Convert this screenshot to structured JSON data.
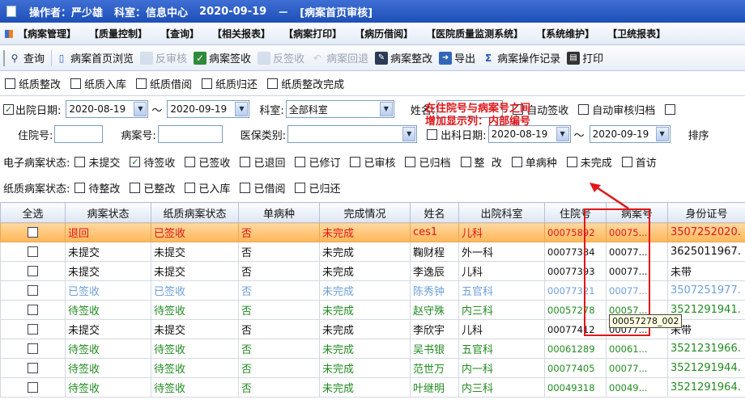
{
  "titlebar": {
    "operator": "操作者：严少雄",
    "dept": "科室：信息中心",
    "date": "2020-09-19",
    "dash": "－",
    "title": "[病案首页审核]"
  },
  "menu": [
    "【病案管理】",
    "【质量控制】",
    "【查询】",
    "【相关报表】",
    "【病案打印】",
    "【病历借阅】",
    "【医院质量监测系统】",
    "【系统维护】",
    "【卫统报表】"
  ],
  "toolbar": [
    {
      "label": "查询",
      "icon": "search-icon",
      "enabled": true
    },
    {
      "label": "病案首页浏览",
      "icon": "document-icon",
      "enabled": true
    },
    {
      "label": "反审核",
      "icon": "undo-icon",
      "enabled": false
    },
    {
      "label": "病案签收",
      "icon": "check-icon",
      "enabled": true
    },
    {
      "label": "反签收",
      "icon": "undo-icon",
      "enabled": false
    },
    {
      "label": "病案回退",
      "icon": "return-icon",
      "enabled": false
    },
    {
      "label": "病案整改",
      "icon": "edit-icon",
      "enabled": true
    },
    {
      "label": "导出",
      "icon": "export-icon",
      "enabled": true
    },
    {
      "label": "病案操作记录",
      "icon": "sigma-icon",
      "enabled": true
    },
    {
      "label": "打印",
      "icon": "print-icon",
      "enabled": true
    }
  ],
  "paper_ops": [
    "纸质整改",
    "纸质入库",
    "纸质借阅",
    "纸质归还",
    "纸质整改完成"
  ],
  "filters": {
    "discharge_date_label": "出院日期:",
    "date_from": "2020-08-19",
    "tilde": "～",
    "date_to": "2020-09-19",
    "dept_label": "科室:",
    "dept_value": "全部科室",
    "name_label": "姓名:",
    "auto_sign": "自动签收",
    "auto_archive": "自动审核归档",
    "inpatient_label": "住院号:",
    "record_label": "病案号:",
    "insurance_label": "医保类别:",
    "out_date_label": "出科日期:",
    "out_from": "2020-08-19",
    "out_to": "2020-09-19",
    "sort_label": "排序"
  },
  "e_status": {
    "label": "电子病案状态:",
    "options": [
      {
        "text": "未提交",
        "checked": false
      },
      {
        "text": "待签收",
        "checked": true
      },
      {
        "text": "已签收",
        "checked": false
      },
      {
        "text": "已退回",
        "checked": false
      },
      {
        "text": "已修订",
        "checked": false
      },
      {
        "text": "已审核",
        "checked": false
      },
      {
        "text": "已归档",
        "checked": false
      },
      {
        "text": "整  改",
        "checked": false
      },
      {
        "text": "单病种",
        "checked": false
      },
      {
        "text": "未完成",
        "checked": false
      },
      {
        "text": "首访",
        "checked": false
      }
    ]
  },
  "p_status": {
    "label": "纸质病案状态:",
    "options": [
      "待整改",
      "已整改",
      "已入库",
      "已借阅",
      "已归还"
    ]
  },
  "annotation": {
    "line1": "在住院号与病案号之间",
    "line2": "增加显示列：内部编号"
  },
  "tooltip": "00057278_002",
  "table": {
    "columns": [
      "全选",
      "病案状态",
      "纸质病案状态",
      "单病种",
      "完成情况",
      "姓名",
      "出院科室",
      "住院号",
      "病案号",
      "身份证号"
    ],
    "rows": [
      {
        "style": "sel",
        "color": "red",
        "cells": [
          "退回",
          "已签收",
          "否",
          "未完成",
          "ces1",
          "儿科",
          "00075892",
          "00075...",
          "3507252020."
        ]
      },
      {
        "style": "",
        "color": "blk",
        "cells": [
          "未提交",
          "未提交",
          "否",
          "未完成",
          "鞠财程",
          "外一科",
          "00077384",
          "00077...",
          "3625011967."
        ]
      },
      {
        "style": "",
        "color": "blk",
        "cells": [
          "未提交",
          "未提交",
          "否",
          "未完成",
          "李逸辰",
          "儿科",
          "00077393",
          "00077...",
          "未带"
        ]
      },
      {
        "style": "",
        "color": "gray",
        "cells": [
          "已签收",
          "已签收",
          "否",
          "未完成",
          "陈秀钟",
          "五官科",
          "00077321",
          "00077...",
          "3507251977."
        ]
      },
      {
        "style": "",
        "color": "grn",
        "cells": [
          "待签收",
          "待签收",
          "否",
          "未完成",
          "赵守殊",
          "内三科",
          "00057278",
          "00057...",
          "3521291941."
        ]
      },
      {
        "style": "",
        "color": "blk",
        "cells": [
          "未提交",
          "未提交",
          "否",
          "未完成",
          "李欣宇",
          "儿科",
          "00077412",
          "00077...",
          "未带"
        ]
      },
      {
        "style": "",
        "color": "grn",
        "cells": [
          "待签收",
          "待签收",
          "否",
          "未完成",
          "吴书银",
          "五官科",
          "00061289",
          "00061...",
          "3521231966."
        ]
      },
      {
        "style": "",
        "color": "grn",
        "cells": [
          "待签收",
          "待签收",
          "否",
          "未完成",
          "范世万",
          "内一科",
          "00077405",
          "00077...",
          "3521291944."
        ]
      },
      {
        "style": "",
        "color": "grn",
        "cells": [
          "待签收",
          "待签收",
          "否",
          "未完成",
          "叶继明",
          "内三科",
          "00049318",
          "00049...",
          "3521291964."
        ]
      }
    ]
  }
}
